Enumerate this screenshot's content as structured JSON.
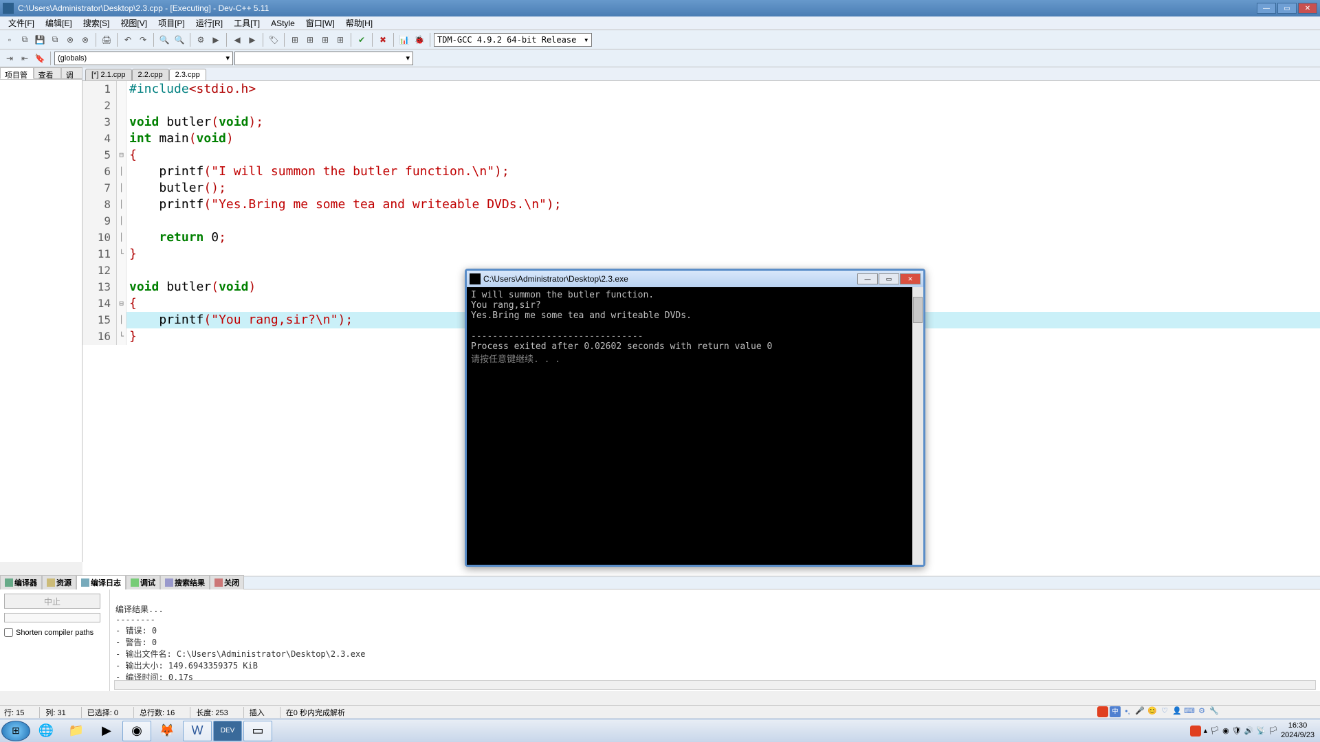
{
  "window": {
    "title": "C:\\Users\\Administrator\\Desktop\\2.3.cpp - [Executing] - Dev-C++ 5.11"
  },
  "menu": {
    "file": "文件[F]",
    "edit": "编辑[E]",
    "search": "搜索[S]",
    "view": "视图[V]",
    "project": "项目[P]",
    "run": "运行[R]",
    "tools": "工具[T]",
    "astyle": "AStyle",
    "window": "窗口[W]",
    "help": "帮助[H]"
  },
  "compiler_select": "TDM-GCC 4.9.2 64-bit Release",
  "globals_select": "(globals)",
  "left_tabs": {
    "project": "项目管理",
    "view_class": "查看类",
    "debug": "调试"
  },
  "editor_tabs": {
    "t1": "[*] 2.1.cpp",
    "t2": "2.2.cpp",
    "t3": "2.3.cpp"
  },
  "code": {
    "l1": {
      "n": "1"
    },
    "l2": {
      "n": "2"
    },
    "l3": {
      "n": "3"
    },
    "l4": {
      "n": "4"
    },
    "l5": {
      "n": "5",
      "fold": "⊟"
    },
    "l6": {
      "n": "6"
    },
    "l7": {
      "n": "7"
    },
    "l8": {
      "n": "8"
    },
    "l9": {
      "n": "9"
    },
    "l10": {
      "n": "10"
    },
    "l11": {
      "n": "11"
    },
    "l12": {
      "n": "12"
    },
    "l13": {
      "n": "13"
    },
    "l14": {
      "n": "14",
      "fold": "⊟"
    },
    "l15": {
      "n": "15"
    },
    "l16": {
      "n": "16"
    },
    "include_pre": "#include",
    "include_hdr": "<stdio.h>",
    "void": "void",
    "int": "int",
    "return": "return",
    "main": " main",
    "butler": " butler",
    "butler2": " butler",
    "printf": "printf",
    "str1": "\"I will summon the butler function.\\n\"",
    "str2": "\"Yes.Bring me some tea and writeable DVDs.\\n\"",
    "str3": "\"You rang,sir?\\n\"",
    "zero": " 0",
    "op_paren": "(",
    "cl_paren": ")",
    "semi": ";",
    "ob": "{",
    "cb": "}",
    "butlercall": "    butler"
  },
  "bottom_tabs": {
    "compiler": "编译器",
    "resource": "资源",
    "compile_log": "编译日志",
    "debug": "调试",
    "search_results": "搜索结果",
    "close": "关闭"
  },
  "compile": {
    "abort": "中止",
    "shorten": "Shorten compiler paths",
    "result_header": "编译结果...",
    "sep": "--------",
    "errors": "- 错误: 0",
    "warnings": "- 警告: 0",
    "output_file": "- 输出文件名: C:\\Users\\Administrator\\Desktop\\2.3.exe",
    "output_size": "- 输出大小: 149.6943359375 KiB",
    "compile_time": "- 编译时间: 0.17s"
  },
  "status": {
    "row": "行:   15",
    "col": "列:   31",
    "sel": "已选择:   0",
    "lines": "总行数:   16",
    "len": "长度:   253",
    "insert": "插入",
    "parsed": "在0 秒内完成解析"
  },
  "console": {
    "title": "C:\\Users\\Administrator\\Desktop\\2.3.exe",
    "l1": "I will summon the butler function.",
    "l2": "You rang,sir?",
    "l3": "Yes.Bring me some tea and writeable DVDs.",
    "l4": "",
    "l5": "--------------------------------",
    "l6": "Process exited after 0.02602 seconds with return value 0",
    "l7": "请按任意键继续. . ."
  },
  "sys": {
    "time": "16:30",
    "date": "2024/9/23"
  }
}
